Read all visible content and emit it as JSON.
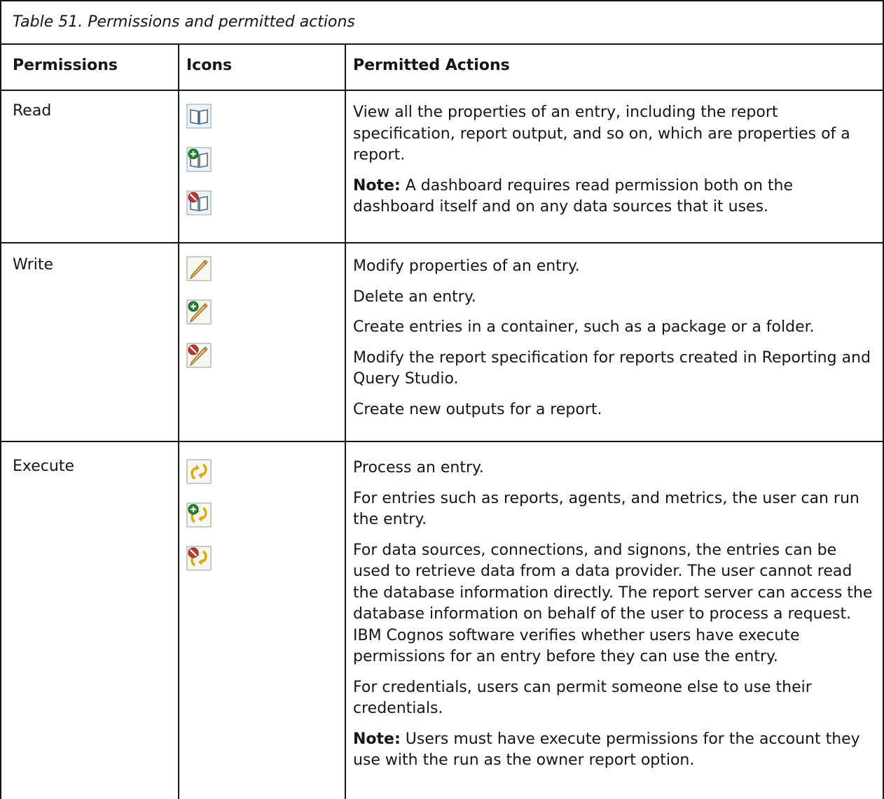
{
  "table": {
    "caption": "Table 51. Permissions and permitted actions",
    "headers": {
      "permissions": "Permissions",
      "icons": "Icons",
      "actions": "Permitted Actions"
    },
    "rows": [
      {
        "permission": "Read",
        "icons": [
          "read-icon",
          "grant-read-icon",
          "deny-read-icon"
        ],
        "actions": [
          {
            "label": "",
            "text": "View all the properties of an entry, including the report specification, report output, and so on, which are properties of a report."
          },
          {
            "label": "Note:",
            "text": " A dashboard requires read permission both on the dashboard itself and on any data sources that it uses."
          }
        ]
      },
      {
        "permission": "Write",
        "icons": [
          "write-icon",
          "grant-write-icon",
          "deny-write-icon"
        ],
        "actions": [
          {
            "label": "",
            "text": "Modify properties of an entry."
          },
          {
            "label": "",
            "text": "Delete an entry."
          },
          {
            "label": "",
            "text": "Create entries in a container, such as a package or a folder."
          },
          {
            "label": "",
            "text": "Modify the report specification for reports created in Reporting and Query Studio."
          },
          {
            "label": "",
            "text": "Create new outputs for a report."
          }
        ]
      },
      {
        "permission": "Execute",
        "icons": [
          "execute-icon",
          "grant-execute-icon",
          "deny-execute-icon"
        ],
        "actions": [
          {
            "label": "",
            "text": "Process an entry."
          },
          {
            "label": "",
            "text": "For entries such as reports, agents, and metrics, the user can run the entry."
          },
          {
            "label": "",
            "text": "For data sources, connections, and signons, the entries can be used to retrieve data from a data provider. The user cannot read the database information directly. The report server can access the database information on behalf of the user to process a request. IBM Cognos software verifies whether users have execute permissions for an entry before they can use the entry."
          },
          {
            "label": "",
            "text": "For credentials, users can permit someone else to use their credentials."
          },
          {
            "label": "Note:",
            "text": " Users must have execute permissions for the account they use with the run as the owner report option."
          }
        ]
      }
    ]
  },
  "colors": {
    "border": "#161616",
    "grant_badge": "#1a8a2a",
    "deny_badge": "#c0392b",
    "execute_arrows": "#e0a800"
  }
}
